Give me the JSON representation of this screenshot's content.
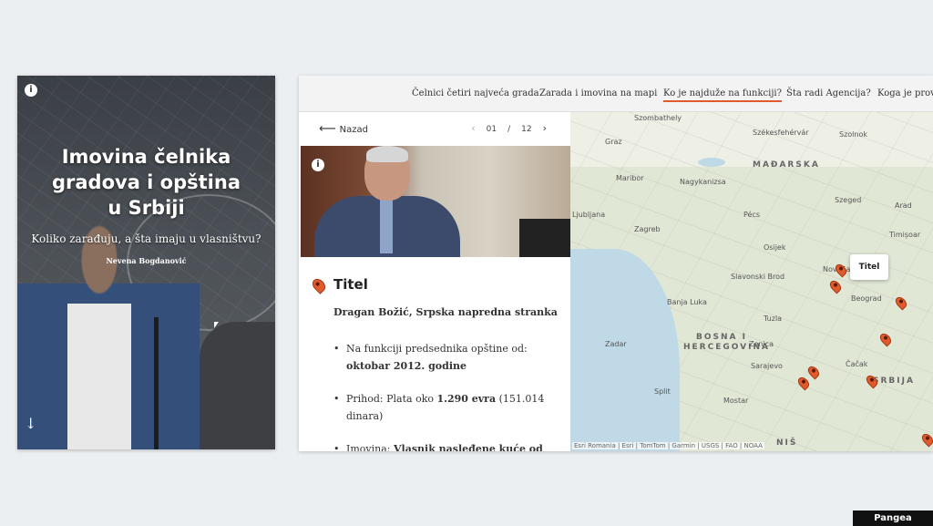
{
  "cover": {
    "title": "Imovina čelnika gradova i opština u Srbiji",
    "subtitle": "Koliko zarađuju, a šta imaju u vlasništvu?",
    "author": "Nevena Bogdanović",
    "info_glyph": "i",
    "scroll_glyph": "↓"
  },
  "nav": {
    "items": [
      {
        "label": "Čelnici četiri najveća grada"
      },
      {
        "label": "Zarada i imovina na mapi"
      },
      {
        "label": "Ko je najduže na funkciji?"
      },
      {
        "label": "Šta radi Agencija?"
      },
      {
        "label": "Koga je prove"
      }
    ]
  },
  "panel": {
    "back_label": "Nazad",
    "back_glyph": "⟵",
    "pager": {
      "current": "01",
      "sep": "/",
      "total": "12",
      "prev": "‹",
      "next": "›"
    },
    "info_glyph": "i",
    "place": "Titel",
    "person": "Dragan Božić, Srpska napredna stranka",
    "facts": [
      {
        "prefix": "Na funkciji predsednika opštine od: ",
        "bold": "oktobar 2012. godine",
        "suffix": ""
      },
      {
        "prefix": "Prihod: Plata oko ",
        "bold": "1.290 evra",
        "suffix": " (151.014 dinara)"
      },
      {
        "prefix": "Imovina: ",
        "bold": "Vlasnik nasleđene kuće od",
        "suffix": ""
      }
    ]
  },
  "map": {
    "labels": [
      "Szombathely",
      "Graz",
      "Székesfehérvár",
      "Szolnok",
      "MAĐARSKA",
      "Maribor",
      "Nagykanizsa",
      "Szeged",
      "Arad",
      "Ljubljana",
      "Zagreb",
      "Pécs",
      "Timișoar",
      "Osijek",
      "Novi Sad",
      "Slavonski Brod",
      "Beograd",
      "Banja Luka",
      "Tuzla",
      "BOSNA I",
      "HERCEGOVINA",
      "Zenica",
      "Zadar",
      "Sarajevo",
      "Čačak",
      "SRBIJA",
      "Split",
      "Mostar",
      "NIŠ"
    ],
    "tooltip": "Titel",
    "attribution": "Esri Romania | Esri | TomTom | Garmin | USGS | FAO | NOAA"
  },
  "badge": "Pangea Showcase",
  "colors": {
    "accent": "#e05a2b",
    "page_bg": "#eceff1"
  }
}
